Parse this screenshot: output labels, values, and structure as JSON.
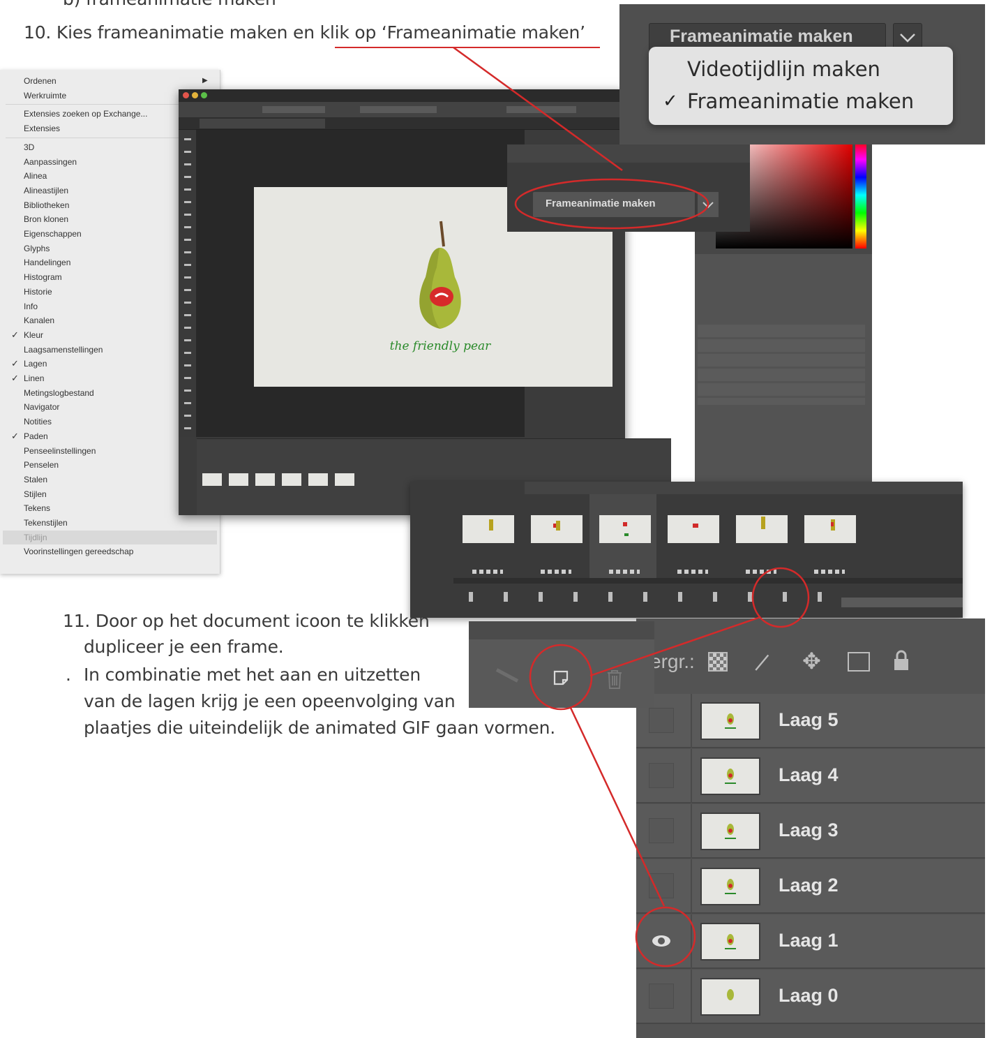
{
  "instructions": {
    "step_b": "b) frameanimatie maken",
    "step10": "10. Kies frameanimatie maken en klik op ‘Frameanimatie maken’",
    "step11_line1": "11. Door op het document icoon te klikken",
    "step11_line2": "dupliceer je een frame.",
    "step_dot": ".",
    "step12_line1": "In combinatie met het aan en uitzetten",
    "step12_line2": "van de lagen krijg je een opeenvolging van",
    "step12_line3": "plaatjes die uiteindelijk de animated GIF gaan vormen."
  },
  "dropdown": {
    "selected": "Frameanimatie maken",
    "options": [
      {
        "label": "Videotijdlijn maken",
        "checked": false
      },
      {
        "label": "Frameanimatie maken",
        "checked": true
      }
    ],
    "check_mark": "✓",
    "chevron_icon": "chevron-down-icon"
  },
  "timeline_button": {
    "label": "Frameanimatie maken"
  },
  "window_menu": {
    "items": [
      {
        "label": "Ordenen",
        "checked": false,
        "submenu": true
      },
      {
        "label": "Werkruimte",
        "checked": false,
        "submenu": true
      },
      {
        "label": "Extensies zoeken op Exchange...",
        "checked": false,
        "sep_before": true
      },
      {
        "label": "Extensies",
        "checked": false
      },
      {
        "label": "3D",
        "checked": false,
        "sep_before": true
      },
      {
        "label": "Aanpassingen",
        "checked": false
      },
      {
        "label": "Alinea",
        "checked": false
      },
      {
        "label": "Alineastijlen",
        "checked": false
      },
      {
        "label": "Bibliotheken",
        "checked": false
      },
      {
        "label": "Bron klonen",
        "checked": false
      },
      {
        "label": "Eigenschappen",
        "checked": false
      },
      {
        "label": "Glyphs",
        "checked": false
      },
      {
        "label": "Handelingen",
        "checked": false
      },
      {
        "label": "Histogram",
        "checked": false
      },
      {
        "label": "Historie",
        "checked": false
      },
      {
        "label": "Info",
        "checked": false
      },
      {
        "label": "Kanalen",
        "checked": false
      },
      {
        "label": "Kleur",
        "checked": true
      },
      {
        "label": "Laagsamenstellingen",
        "checked": false
      },
      {
        "label": "Lagen",
        "checked": true
      },
      {
        "label": "Linen",
        "checked": true
      },
      {
        "label": "Metingslogbestand",
        "checked": false
      },
      {
        "label": "Navigator",
        "checked": false
      },
      {
        "label": "Notities",
        "checked": false
      },
      {
        "label": "Paden",
        "checked": true
      },
      {
        "label": "Penseelinstellingen",
        "checked": false
      },
      {
        "label": "Penselen",
        "checked": false
      },
      {
        "label": "Stalen",
        "checked": false
      },
      {
        "label": "Stijlen",
        "checked": false
      },
      {
        "label": "Tekens",
        "checked": false
      },
      {
        "label": "Tekenstijlen",
        "checked": false
      },
      {
        "label": "Tijdlijn",
        "checked": false,
        "highlighted": true
      },
      {
        "label": "Voorinstellingen gereedschap",
        "checked": false
      }
    ]
  },
  "canvas": {
    "tagline": "the friendly pear"
  },
  "layers_panel": {
    "lock_label": "ergr.:",
    "layers": [
      {
        "name": "Laag 5",
        "visible": false
      },
      {
        "name": "Laag 4",
        "visible": false
      },
      {
        "name": "Laag 3",
        "visible": false
      },
      {
        "name": "Laag 2",
        "visible": false
      },
      {
        "name": "Laag 1",
        "visible": true
      },
      {
        "name": "Laag 0",
        "visible": false
      }
    ]
  },
  "colors": {
    "annotation_red": "#d42a2a",
    "ps_dark": "#2b2b2b",
    "ps_panel": "#535353",
    "text": "#3a3a3a"
  }
}
